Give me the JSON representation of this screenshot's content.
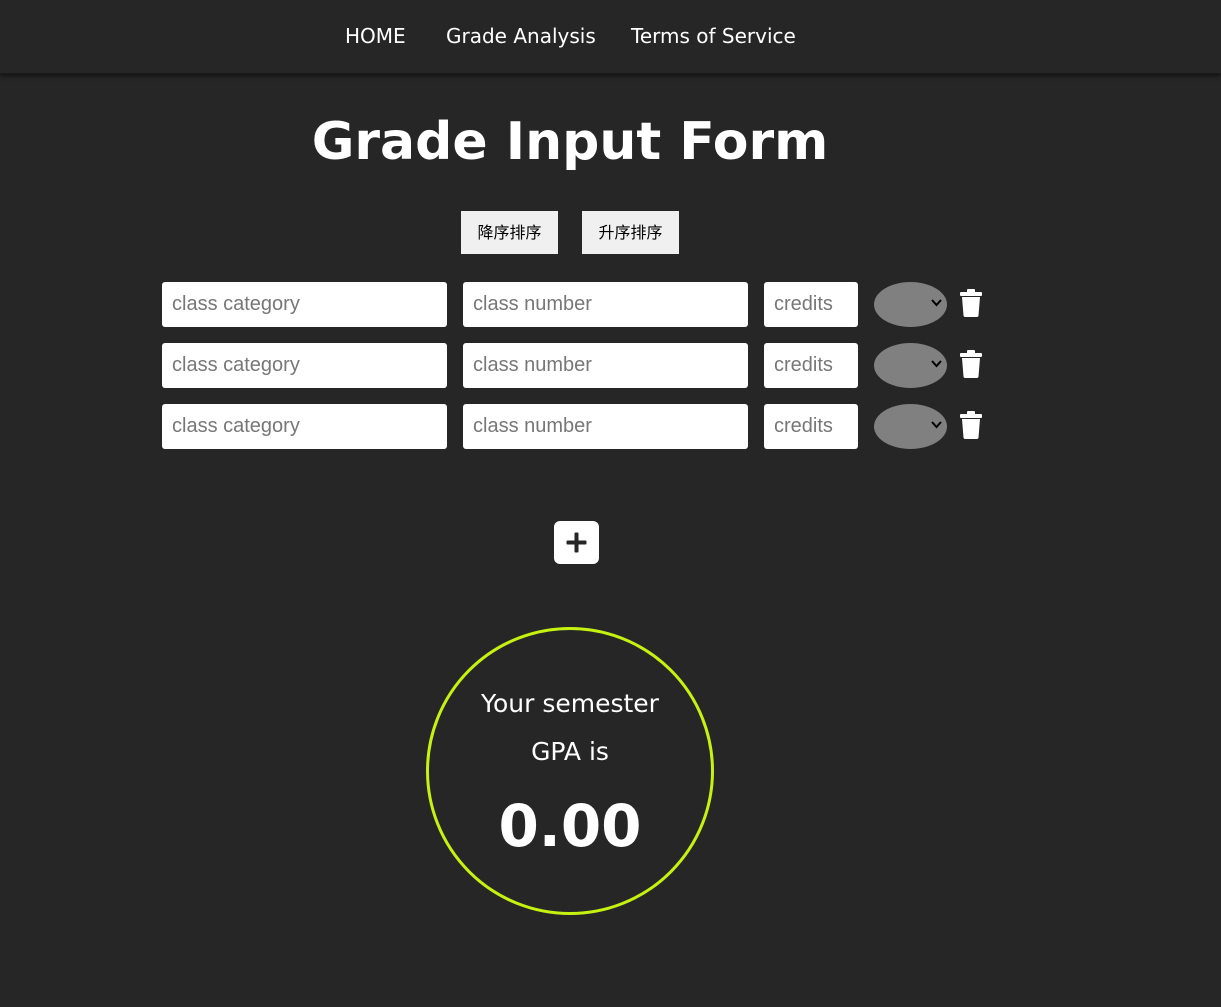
{
  "nav": {
    "home": "HOME",
    "analysis": "Grade Analysis",
    "terms": "Terms of Service"
  },
  "title": "Grade Input Form",
  "sort": {
    "descending": "降序排序",
    "ascending": "升序排序"
  },
  "rows": [
    {
      "category_placeholder": "class category",
      "category_value": "",
      "number_placeholder": "class number",
      "number_value": "",
      "credits_placeholder": "credits",
      "credits_value": "",
      "grade": ""
    },
    {
      "category_placeholder": "class category",
      "category_value": "",
      "number_placeholder": "class number",
      "number_value": "",
      "credits_placeholder": "credits",
      "credits_value": "",
      "grade": ""
    },
    {
      "category_placeholder": "class category",
      "category_value": "",
      "number_placeholder": "class number",
      "number_value": "",
      "credits_placeholder": "credits",
      "credits_value": "",
      "grade": ""
    }
  ],
  "icons": {
    "delete": "trash-icon",
    "add": "plus-icon",
    "select": "chevron-down-icon"
  },
  "gpa": {
    "label": "Your semester GPA is",
    "value": "0.00"
  },
  "colors": {
    "background": "#262626",
    "accent": "#c6f211",
    "select": "#808080"
  }
}
